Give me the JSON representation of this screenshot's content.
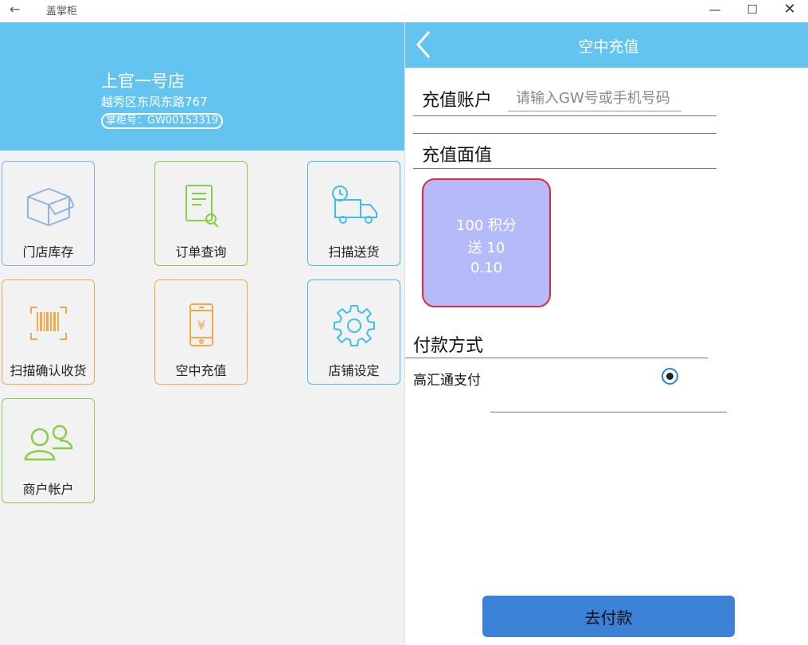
{
  "window": {
    "title": "盖掌柜",
    "back_glyph": "←",
    "minimize_glyph": "—",
    "maximize_glyph": "☐",
    "close_glyph": "✕"
  },
  "store": {
    "name": "上官一号店",
    "address": "越秀区东风东路767",
    "code": "掌柜号：GW00153319"
  },
  "tiles": [
    {
      "label": "门店库存",
      "icon": "box-icon",
      "color": "#7fb2e3"
    },
    {
      "label": "订单查询",
      "icon": "order-search-icon",
      "color": "#86cf44"
    },
    {
      "label": "扫描送货",
      "icon": "delivery-truck-icon",
      "color": "#3fbfe6"
    },
    {
      "label": "扫描确认收货",
      "icon": "barcode-scan-icon",
      "color": "#f3a94a"
    },
    {
      "label": "空中充值",
      "icon": "phone-yuan-icon",
      "color": "#f3a94a"
    },
    {
      "label": "店铺设定",
      "icon": "gear-icon",
      "color": "#3fbfe6"
    },
    {
      "label": "商户帐户",
      "icon": "users-icon",
      "color": "#86cf44"
    }
  ],
  "recharge": {
    "title": "空中充值",
    "account_label": "充值账户",
    "account_placeholder": "请输入GW号或手机号码",
    "account_value": "",
    "face_value_label": "充值面值",
    "card": {
      "line1": "100 积分",
      "line2": "送 10",
      "line3": "0.10"
    },
    "payment_label": "付款方式",
    "payment_option": "高汇通支付",
    "payment_selected": true,
    "pay_button": "去付款"
  },
  "colors": {
    "header_blue": "#64c4f0",
    "card_fill": "#b5baf8",
    "card_border": "#e0283a",
    "pay_button": "#3b82d6",
    "radio": "#1e8ad6"
  }
}
